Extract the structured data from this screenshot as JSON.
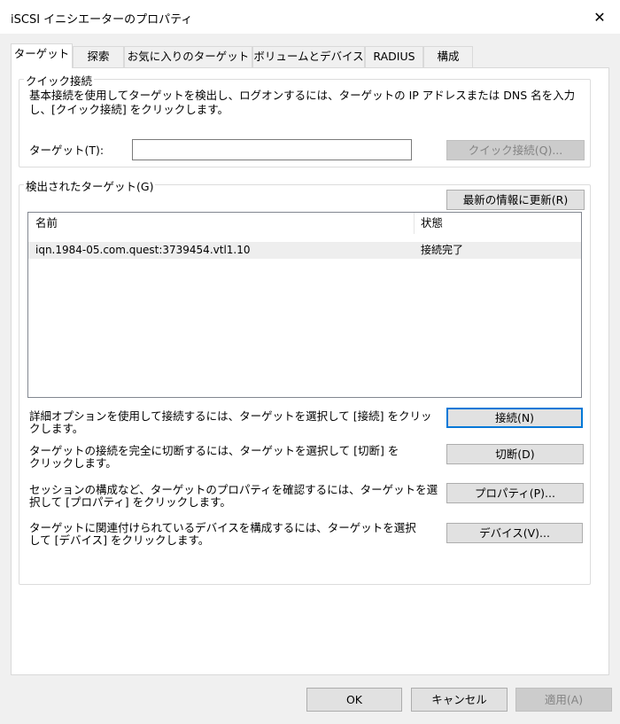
{
  "window": {
    "title": "iSCSI イニシエーターのプロパティ",
    "close_glyph": "✕"
  },
  "tabs": [
    {
      "label": "ターゲット"
    },
    {
      "label": "探索"
    },
    {
      "label": "お気に入りのターゲット"
    },
    {
      "label": "ボリュームとデバイス"
    },
    {
      "label": "RADIUS"
    },
    {
      "label": "構成"
    }
  ],
  "quick_connect": {
    "legend": "クイック接続",
    "desc_line1": "基本接続を使用してターゲットを検出し、ログオンするには、ターゲットの IP アドレスまたは DNS 名を入力",
    "desc_line2": "し、[クイック接続] をクリックします。",
    "target_label": "ターゲット(T):",
    "target_value": "",
    "button": "クイック接続(Q)..."
  },
  "discovered": {
    "legend": "検出されたターゲット(G)",
    "refresh_button": "最新の情報に更新(R)",
    "columns": [
      "名前",
      "状態"
    ],
    "rows": [
      {
        "name": "iqn.1984-05.com.quest:3739454.vtl1.10",
        "status": "接続完了"
      }
    ],
    "actions": [
      {
        "line1": "詳細オプションを使用して接続するには、ターゲットを選択して [接続] をクリッ",
        "line2": "クします。",
        "button": "接続(N)"
      },
      {
        "line1": "ターゲットの接続を完全に切断するには、ターゲットを選択して [切断] を",
        "line2": "クリックします。",
        "button": "切断(D)"
      },
      {
        "line1": "セッションの構成など、ターゲットのプロパティを確認するには、ターゲットを選",
        "line2": "択して [プロパティ] をクリックします。",
        "button": "プロパティ(P)..."
      },
      {
        "line1": "ターゲットに関連付けられているデバイスを構成するには、ターゲットを選択",
        "line2": "して [デバイス] をクリックします。",
        "button": "デバイス(V)..."
      }
    ]
  },
  "footer": {
    "ok": "OK",
    "cancel": "キャンセル",
    "apply": "適用(A)"
  }
}
